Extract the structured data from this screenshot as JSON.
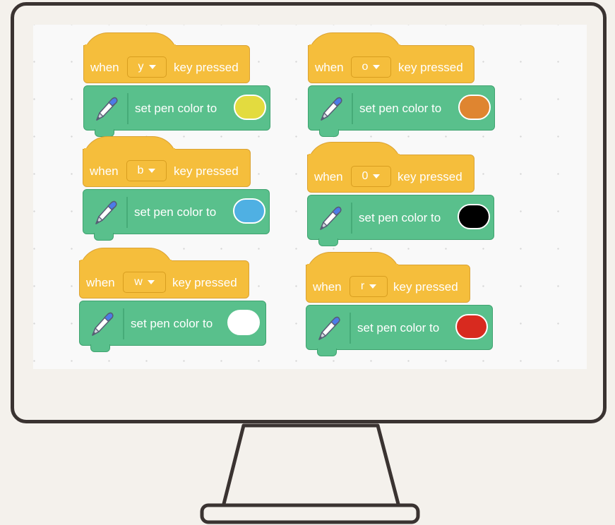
{
  "blocks": [
    {
      "when": "when",
      "key": "y",
      "pressed": "key pressed",
      "action": "set pen color to",
      "color": "#e3db3f"
    },
    {
      "when": "when",
      "key": "o",
      "pressed": "key pressed",
      "action": "set pen color to",
      "color": "#df8530"
    },
    {
      "when": "when",
      "key": "b",
      "pressed": "key pressed",
      "action": "set pen color to",
      "color": "#4fb0e3"
    },
    {
      "when": "when",
      "key": "0",
      "pressed": "key pressed",
      "action": "set pen color to",
      "color": "#000000"
    },
    {
      "when": "when",
      "key": "w",
      "pressed": "key pressed",
      "action": "set pen color to",
      "color": "#ffffff"
    },
    {
      "when": "when",
      "key": "r",
      "pressed": "key pressed",
      "action": "set pen color to",
      "color": "#d82a1f"
    }
  ],
  "colors": {
    "hat": "#f5be3c",
    "pen": "#59c08c",
    "monitor": "#3a3331"
  },
  "icons": {
    "pen": "pen-icon",
    "dropdown": "caret-down-icon"
  }
}
